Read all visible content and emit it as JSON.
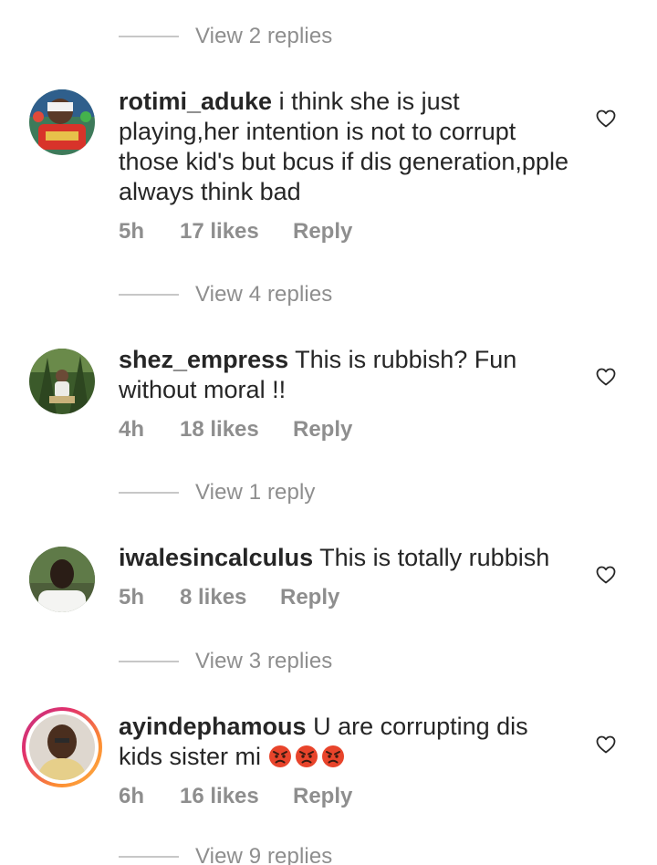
{
  "threads": [
    {
      "view_replies": "View 2 replies"
    },
    {
      "comment": {
        "username": "rotimi_aduke",
        "text": "i think she is just playing,her intention is not to corrupt those kid's but bcus if dis generation,pple always think bad",
        "time": "5h",
        "likes": "17 likes",
        "reply": "Reply",
        "avatar_icon": "avatar-photo"
      }
    },
    {
      "view_replies": "View 4 replies"
    },
    {
      "comment": {
        "username": "shez_empress",
        "text": "This is rubbish? Fun without moral !!",
        "time": "4h",
        "likes": "18 likes",
        "reply": "Reply",
        "avatar_icon": "avatar-photo"
      }
    },
    {
      "view_replies": "View 1 reply"
    },
    {
      "comment": {
        "username": "iwalesincalculus",
        "text": "This is totally rubbish",
        "time": "5h",
        "likes": "8 likes",
        "reply": "Reply",
        "avatar_icon": "avatar-photo"
      }
    },
    {
      "view_replies": "View 3 replies"
    },
    {
      "comment": {
        "username": "ayindephamous",
        "text": "U are corrupting dis kids sister mi",
        "emojis": [
          "angry-face",
          "angry-face",
          "angry-face"
        ],
        "time": "6h",
        "likes": "16 likes",
        "reply": "Reply",
        "avatar_icon": "avatar-photo",
        "has_story_ring": true
      }
    },
    {
      "view_replies": "View 9 replies"
    }
  ],
  "colors": {
    "text": "#262626",
    "secondary": "#8e8e8e",
    "divider": "#c7c7c7",
    "story_ring": "#e1306c"
  },
  "icons": {
    "like": "heart-outline-icon",
    "emoji": "angry-face"
  }
}
